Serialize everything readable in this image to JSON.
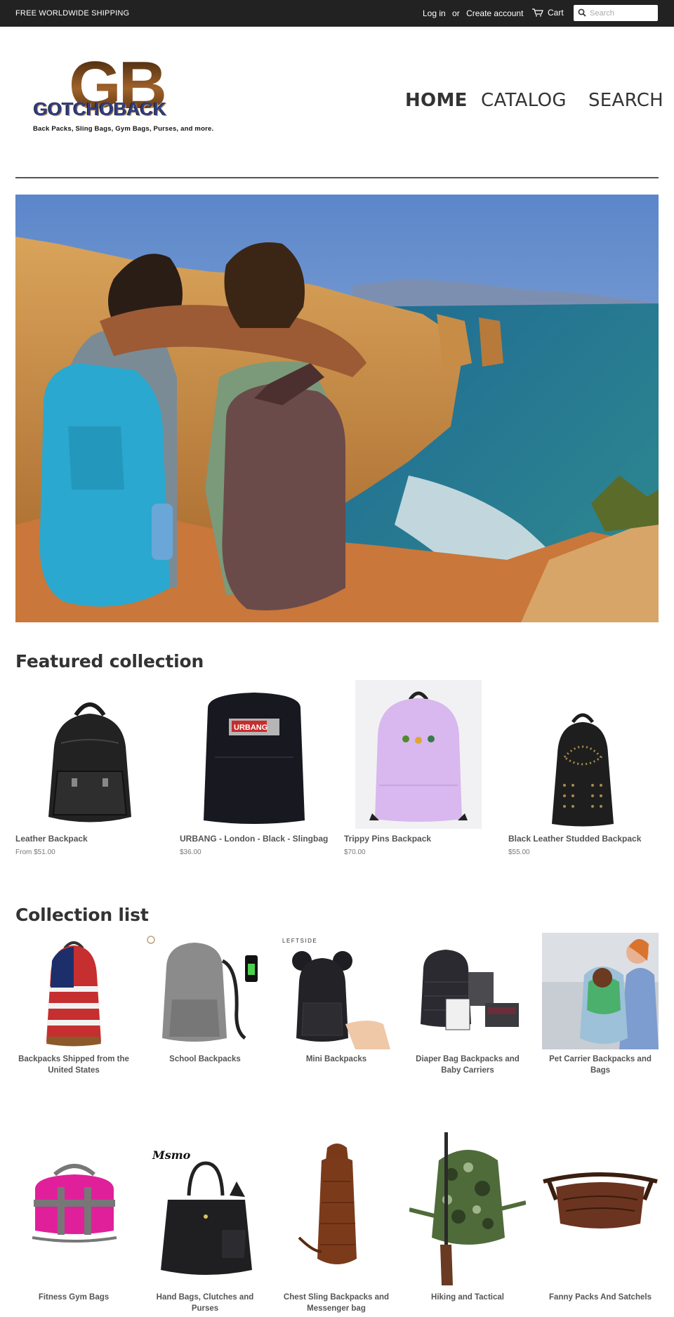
{
  "topbar": {
    "shipping": "FREE WORLDWIDE SHIPPING",
    "login": "Log in",
    "or": "or",
    "create_account": "Create account",
    "cart": "Cart",
    "search_placeholder": "Search"
  },
  "logo": {
    "letters": "GB",
    "wordmark": "GOTCHOBACK",
    "tagline": "Back Packs, Sling Bags, Gym Bags, Purses, and more."
  },
  "nav": {
    "home": "HOME",
    "catalog": "CATALOG",
    "search": "SEARCH"
  },
  "featured": {
    "heading": "Featured collection",
    "products": [
      {
        "title": "Leather Backpack",
        "price": "From $51.00"
      },
      {
        "title": "URBANG - London - Black - Slingbag",
        "price": "$36.00"
      },
      {
        "title": "Trippy Pins Backpack",
        "price": "$70.00"
      },
      {
        "title": "Black Leather Studded Backpack",
        "price": "$55.00"
      }
    ]
  },
  "collections": {
    "heading": "Collection list",
    "items": [
      {
        "title": "Backpacks Shipped from the United States"
      },
      {
        "title": "School Backpacks"
      },
      {
        "title": "Mini Backpacks"
      },
      {
        "title": "Diaper Bag Backpacks and Baby Carriers"
      },
      {
        "title": "Pet Carrier Backpacks and Bags"
      },
      {
        "title": "Fitness Gym Bags"
      },
      {
        "title": "Hand Bags, Clutches and Purses"
      },
      {
        "title": "Chest Sling Backpacks and Messenger bag"
      },
      {
        "title": "Hiking and Tactical"
      },
      {
        "title": "Fanny Packs And Satchels"
      }
    ]
  },
  "image_text": {
    "urbang_label": "URBANG",
    "leftside_brand": "LEFTSIDE",
    "msmo_brand": "Msmo"
  },
  "colors": {
    "topbar_bg": "#222222",
    "text": "#333333",
    "muted": "#777777"
  }
}
